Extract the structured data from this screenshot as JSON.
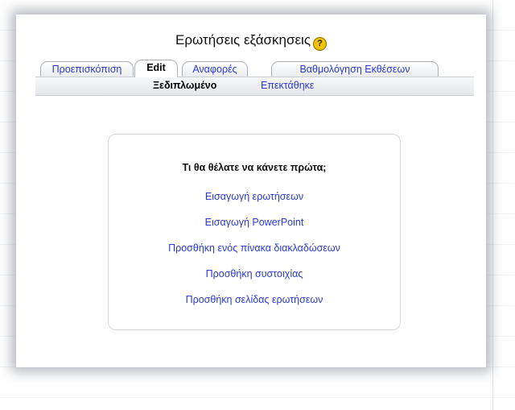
{
  "page": {
    "title": "Ερωτήσεις εξάσκησεις",
    "help_icon": "question-help-icon",
    "help_glyph": "?"
  },
  "tabs": [
    {
      "label": "Προεπισκόπιση",
      "active": false
    },
    {
      "label": "Edit",
      "active": true
    },
    {
      "label": "Αναφορές",
      "active": false
    },
    {
      "label": "Βαθμολόγηση Εκθέσεων",
      "active": false
    }
  ],
  "subtabs": [
    {
      "label": "Ξεδιπλωμένο",
      "active": true
    },
    {
      "label": "Επεκτάθηκε",
      "active": false
    }
  ],
  "panel": {
    "prompt": "Τι θα θέλατε να κάνετε πρώτα;",
    "actions": [
      "Εισαγωγή ερωτήσεων",
      "Εισαγωγή PowerPoint",
      "Προσθήκη ενός πίνακα διακλαδώσεων",
      "Προσθήκη συστοιχίας",
      "Προσθήκη σελίδας ερωτήσεων"
    ]
  },
  "colors": {
    "link": "#2a3ad0",
    "help_icon": "#f2c400"
  }
}
